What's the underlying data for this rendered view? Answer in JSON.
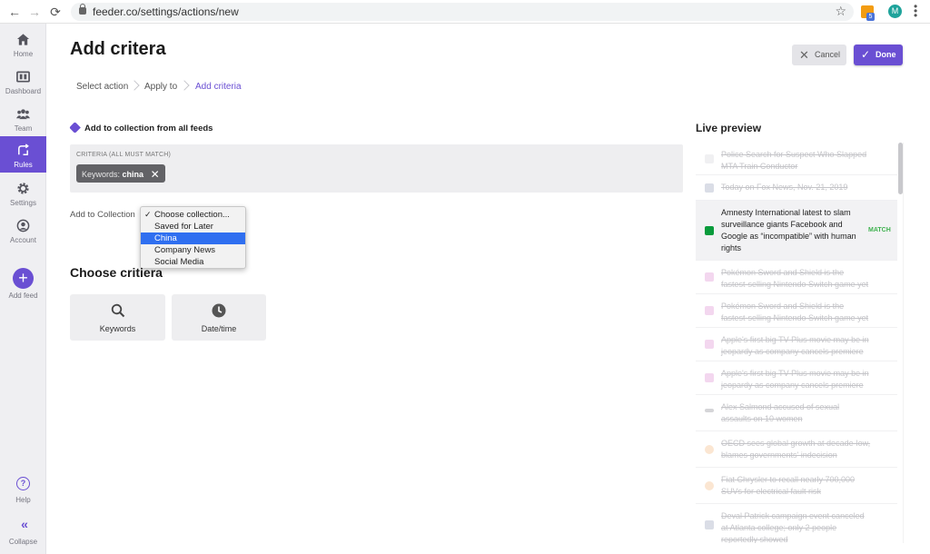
{
  "browser": {
    "url": "feeder.co/settings/actions/new",
    "back_icon": "←",
    "forward_icon": "→",
    "reload_icon": "⟳",
    "star_icon": "☆",
    "rss_badge": "5",
    "avatar_letter": "M"
  },
  "sidebar": {
    "items": [
      {
        "label": "Home",
        "icon": "home-icon"
      },
      {
        "label": "Dashboard",
        "icon": "dashboard-icon"
      },
      {
        "label": "Team",
        "icon": "team-icon"
      },
      {
        "label": "Rules",
        "icon": "rules-icon",
        "active": true
      },
      {
        "label": "Settings",
        "icon": "gear-icon"
      },
      {
        "label": "Account",
        "icon": "account-icon"
      }
    ],
    "add_feed": {
      "label": "Add feed",
      "icon": "+"
    },
    "help": {
      "label": "Help",
      "icon": "?"
    },
    "collapse": {
      "label": "Collapse",
      "icon": "«"
    }
  },
  "header": {
    "title": "Add critera",
    "cancel_label": "Cancel",
    "done_label": "Done"
  },
  "breadcrumbs": [
    "Select action",
    "Apply to",
    "Add criteria"
  ],
  "action": {
    "label": "Add to collection from all feeds"
  },
  "criteria": {
    "heading": "CRITERIA (ALL MUST MATCH)",
    "chip_key": "Keywords:",
    "chip_value": "china",
    "chip_close": "✕"
  },
  "collection": {
    "label": "Add to Collection",
    "options": [
      "Choose collection...",
      "Saved for Later",
      "China",
      "Company News",
      "Social Media"
    ],
    "checked_index": 0,
    "highlighted_index": 2
  },
  "choose": {
    "title": "Choose critiera",
    "cards": [
      {
        "label": "Keywords",
        "icon": "search-icon"
      },
      {
        "label": "Date/time",
        "icon": "clock-icon"
      }
    ]
  },
  "live_preview": {
    "title": "Live preview",
    "match_label": "MATCH",
    "items": [
      {
        "text": "Police Search for Suspect Who Slapped MTA Train Conductor"
      },
      {
        "text": "Today on Fox News, Nov. 21, 2019"
      },
      {
        "text": "Amnesty International latest to slam surveillance giants Facebook and Google as “incompatible” with human rights",
        "match": true
      },
      {
        "text": "Pokémon Sword and Shield is the fastest-selling Nintendo Switch game yet"
      },
      {
        "text": "Pokémon Sword and Shield is the fastest-selling Nintendo Switch game yet"
      },
      {
        "text": "Apple's first big TV Plus movie may be in jeopardy as company cancels premiere"
      },
      {
        "text": "Apple's first big TV Plus movie may be in jeopardy as company cancels premiere"
      },
      {
        "text": "Alex Salmond accused of sexual assaults on 10 women"
      },
      {
        "text": "OECD sees global growth at decade-low, blames governments' indecision"
      },
      {
        "text": "Fiat Chrysler to recall nearly 700,000 SUVs for electrical fault risk"
      },
      {
        "text": "Deval Patrick campaign event canceled at Atlanta college; only 2 people reportedly showed"
      }
    ]
  },
  "colors": {
    "accent": "#6a4fd3",
    "match": "#3fb24f",
    "highlight": "#2f6ff0"
  }
}
